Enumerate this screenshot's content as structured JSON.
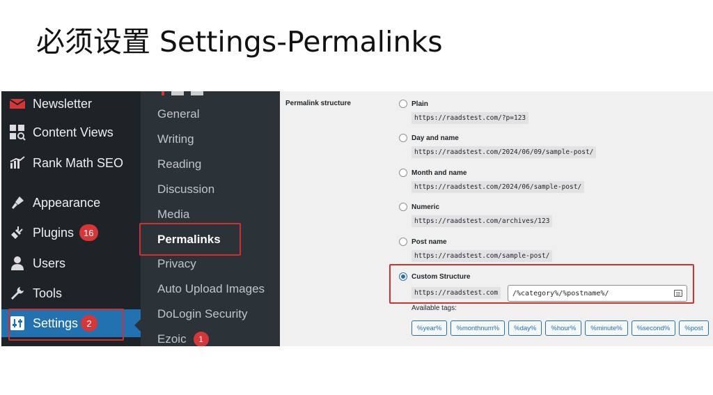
{
  "slide": {
    "title": "必须设置 Settings-Permalinks"
  },
  "admin_menu": {
    "items": [
      {
        "label": "Newsletter",
        "icon": "envelope-icon"
      },
      {
        "label": "Content Views",
        "icon": "grid-search-icon"
      },
      {
        "label": "Rank Math SEO",
        "icon": "chart-icon"
      },
      {
        "label": "Appearance",
        "icon": "paintbrush-icon"
      },
      {
        "label": "Plugins",
        "icon": "plugin-icon",
        "badge": "16"
      },
      {
        "label": "Users",
        "icon": "user-icon"
      },
      {
        "label": "Tools",
        "icon": "wrench-icon"
      },
      {
        "label": "Settings",
        "icon": "settings-sliders-icon",
        "badge": "2",
        "active": true
      }
    ]
  },
  "submenu": {
    "items": [
      {
        "label": "General"
      },
      {
        "label": "Writing"
      },
      {
        "label": "Reading"
      },
      {
        "label": "Discussion"
      },
      {
        "label": "Media"
      },
      {
        "label": "Permalinks",
        "current": true
      },
      {
        "label": "Privacy"
      },
      {
        "label": "Auto Upload Images"
      },
      {
        "label": "DoLogin Security"
      },
      {
        "label": "Ezoic",
        "badge": "1"
      }
    ]
  },
  "permalinks": {
    "heading": "Permalink structure",
    "options": [
      {
        "label": "Plain",
        "example": "https://raadstest.com/?p=123",
        "checked": false
      },
      {
        "label": "Day and name",
        "example": "https://raadstest.com/2024/06/09/sample-post/",
        "checked": false
      },
      {
        "label": "Month and name",
        "example": "https://raadstest.com/2024/06/sample-post/",
        "checked": false
      },
      {
        "label": "Numeric",
        "example": "https://raadstest.com/archives/123",
        "checked": false
      },
      {
        "label": "Post name",
        "example": "https://raadstest.com/sample-post/",
        "checked": false
      },
      {
        "label": "Custom Structure",
        "example": "https://raadstest.com",
        "checked": true
      }
    ],
    "custom_value": "/%category%/%postname%/",
    "available_tags_label": "Available tags:",
    "tags": [
      "%year%",
      "%monthnum%",
      "%day%",
      "%hour%",
      "%minute%",
      "%second%",
      "%post"
    ]
  },
  "colors": {
    "menu_bg": "#1d2327",
    "submenu_bg": "#2c3338",
    "accent": "#2271b1",
    "badge": "#d63638",
    "highlight": "#d0302f"
  }
}
